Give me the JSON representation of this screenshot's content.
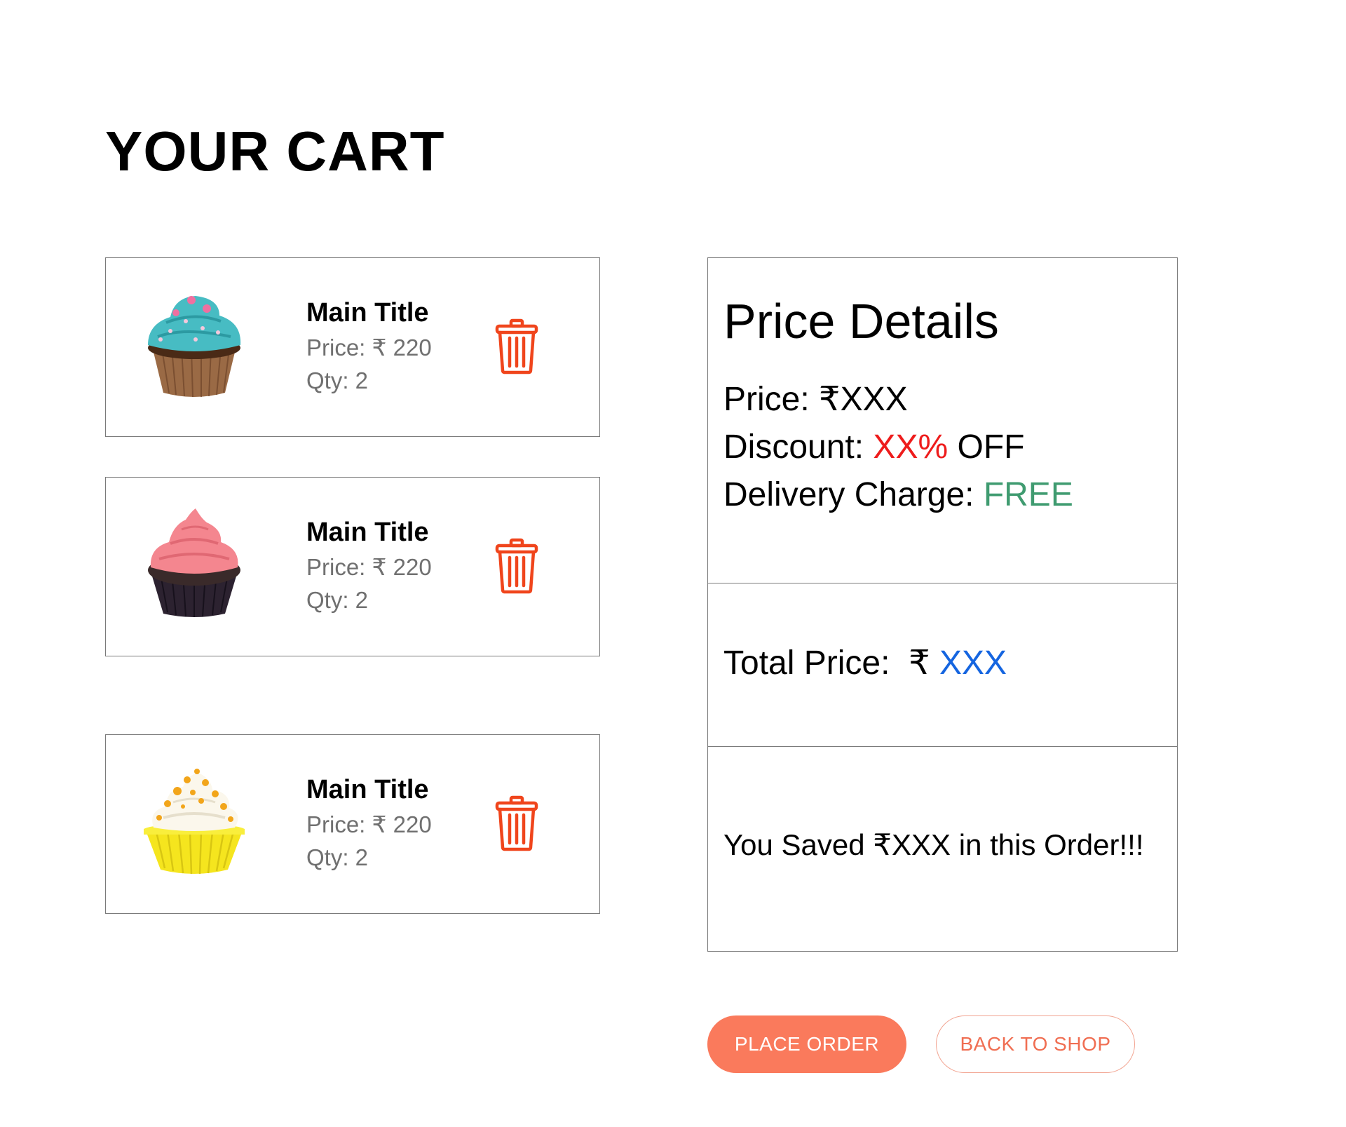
{
  "page": {
    "title": "YOUR CART"
  },
  "cart": {
    "items": [
      {
        "title": "Main Title",
        "price": "Price: ₹ 220",
        "qty": "Qty: 2",
        "image": "cupcake-teal-frosting"
      },
      {
        "title": "Main Title",
        "price": "Price: ₹ 220",
        "qty": "Qty: 2",
        "image": "cupcake-pink-frosting"
      },
      {
        "title": "Main Title",
        "price": "Price: ₹ 220",
        "qty": "Qty: 2",
        "image": "cupcake-yellow-cream"
      }
    ],
    "delete_icon": "trash-icon"
  },
  "price_details": {
    "heading": "Price Details",
    "price_label": "Price: ",
    "price_value": "₹XXX",
    "discount_label": "Discount: ",
    "discount_value": "XX%",
    "discount_suffix": " OFF",
    "delivery_label": "Delivery Charge: ",
    "delivery_value": "FREE",
    "total_label": "Total Price:  ₹ ",
    "total_value": "XXX",
    "saved_text": "You Saved ₹XXX in this Order!!!"
  },
  "actions": {
    "place_order": "PLACE ORDER",
    "back_to_shop": "BACK TO SHOP"
  },
  "colors": {
    "accent": "#fa7a5c",
    "trash": "#f0451c",
    "discount": "#ee1c1c",
    "free": "#3f9b70",
    "total": "#1565e0"
  }
}
